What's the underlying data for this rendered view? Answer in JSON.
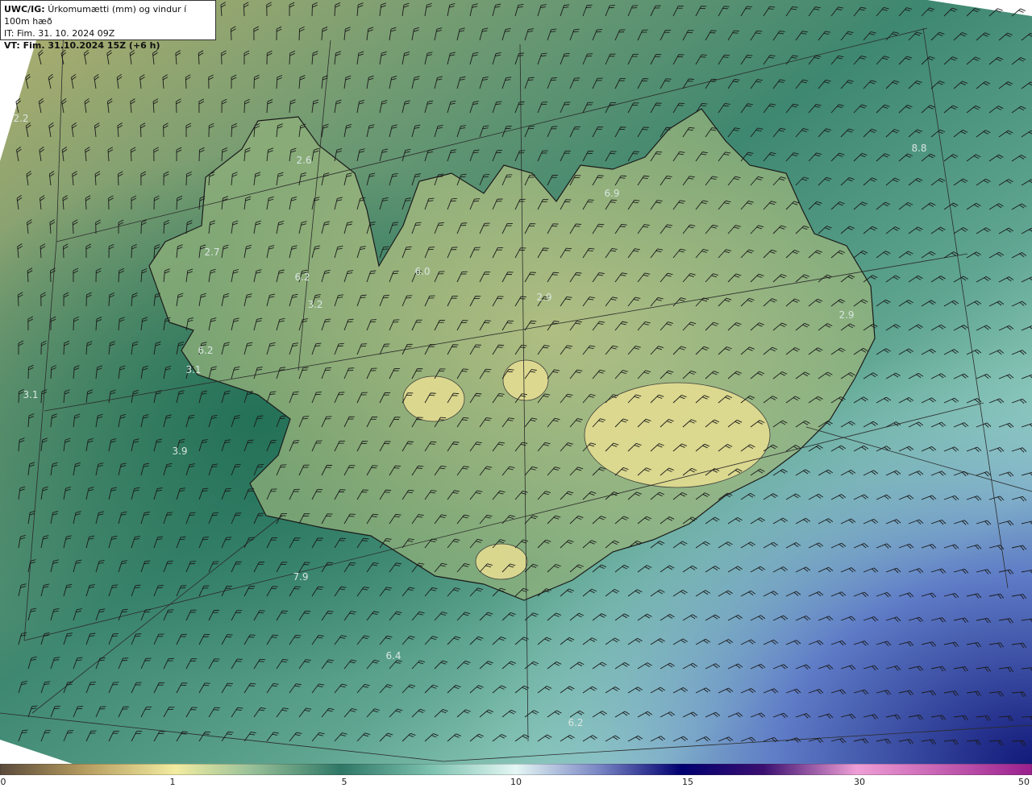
{
  "header": {
    "model": "UWC/IG:",
    "title": "Úrkomumætti (mm) og vindur í 100m hæð",
    "it_line": "IT: Fim. 31. 10. 2024 09Z",
    "vt_line": "VT: Fim. 31.10.2024 15Z (+6 h)"
  },
  "map": {
    "point_labels": [
      {
        "name": "label-1",
        "text": "2.2"
      },
      {
        "name": "label-2",
        "text": "2.6"
      },
      {
        "name": "label-3",
        "text": "2.7"
      },
      {
        "name": "label-4",
        "text": "6.2"
      },
      {
        "name": "label-5",
        "text": "3.2"
      },
      {
        "name": "label-6",
        "text": "6.0"
      },
      {
        "name": "label-7",
        "text": "6.2"
      },
      {
        "name": "label-8",
        "text": "3.1"
      },
      {
        "name": "label-9",
        "text": "3.1"
      },
      {
        "name": "label-10",
        "text": "3.9"
      },
      {
        "name": "label-11",
        "text": "6.9"
      },
      {
        "name": "label-12",
        "text": "2.9"
      },
      {
        "name": "label-13",
        "text": "2.9"
      },
      {
        "name": "label-14",
        "text": "8.8"
      },
      {
        "name": "label-15",
        "text": "7.9"
      },
      {
        "name": "label-16",
        "text": "6.4"
      },
      {
        "name": "label-17",
        "text": "6.2"
      }
    ]
  },
  "colorbar": {
    "ticks": [
      "0",
      "1",
      "5",
      "10",
      "15",
      "30",
      "50"
    ],
    "colors": [
      "#5a4a3a",
      "#b49a5e",
      "#e6d98a",
      "#f2eca0",
      "#9dc39a",
      "#3f8a73",
      "#2e7766",
      "#7fc3b1",
      "#c9eee7",
      "#e4f7f4",
      "#7a86c4",
      "#1c237e",
      "#000070",
      "#3b0f70",
      "#c86bb6",
      "#ef9fd6",
      "#c050b0",
      "#9a1f8d"
    ]
  }
}
